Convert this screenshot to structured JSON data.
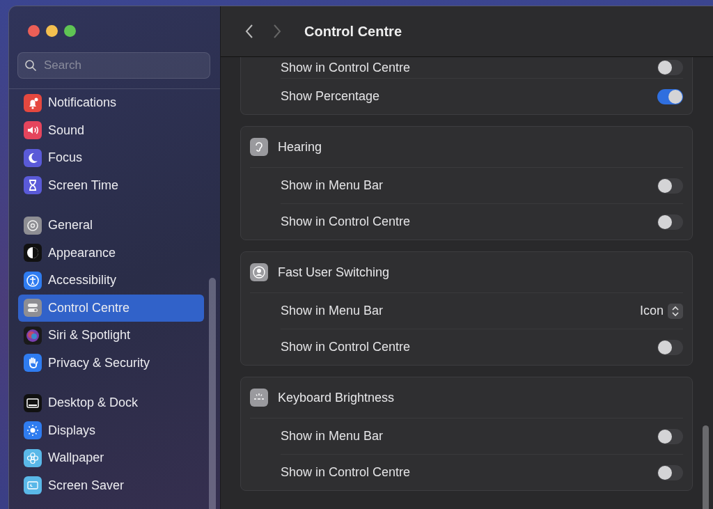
{
  "window": {
    "title": "Control Centre",
    "back_disabled": false,
    "forward_disabled": true
  },
  "sidebar": {
    "search": {
      "placeholder": "Search"
    },
    "groups": [
      [
        {
          "label": "Notifications",
          "selected": false
        },
        {
          "label": "Sound",
          "selected": false
        },
        {
          "label": "Focus",
          "selected": false
        },
        {
          "label": "Screen Time",
          "selected": false
        }
      ],
      [
        {
          "label": "General",
          "selected": false
        },
        {
          "label": "Appearance",
          "selected": false
        },
        {
          "label": "Accessibility",
          "selected": false
        },
        {
          "label": "Control Centre",
          "selected": true
        },
        {
          "label": "Siri & Spotlight",
          "selected": false
        },
        {
          "label": "Privacy & Security",
          "selected": false
        }
      ],
      [
        {
          "label": "Desktop & Dock",
          "selected": false
        },
        {
          "label": "Displays",
          "selected": false
        },
        {
          "label": "Wallpaper",
          "selected": false
        },
        {
          "label": "Screen Saver",
          "selected": false
        }
      ]
    ]
  },
  "sections": [
    {
      "rows": [
        {
          "kind": "toggle",
          "label": "Show in Control Centre",
          "on": false
        },
        {
          "kind": "toggle",
          "label": "Show Percentage",
          "on": true
        }
      ]
    },
    {
      "title": "Hearing",
      "rows": [
        {
          "kind": "toggle",
          "label": "Show in Menu Bar",
          "on": false
        },
        {
          "kind": "toggle",
          "label": "Show in Control Centre",
          "on": false
        }
      ]
    },
    {
      "title": "Fast User Switching",
      "rows": [
        {
          "kind": "popup",
          "label": "Show in Menu Bar",
          "value": "Icon"
        },
        {
          "kind": "toggle",
          "label": "Show in Control Centre",
          "on": false
        }
      ]
    },
    {
      "title": "Keyboard Brightness",
      "rows": [
        {
          "kind": "toggle",
          "label": "Show in Menu Bar",
          "on": false
        },
        {
          "kind": "toggle",
          "label": "Show in Control Centre",
          "on": false
        }
      ]
    }
  ]
}
